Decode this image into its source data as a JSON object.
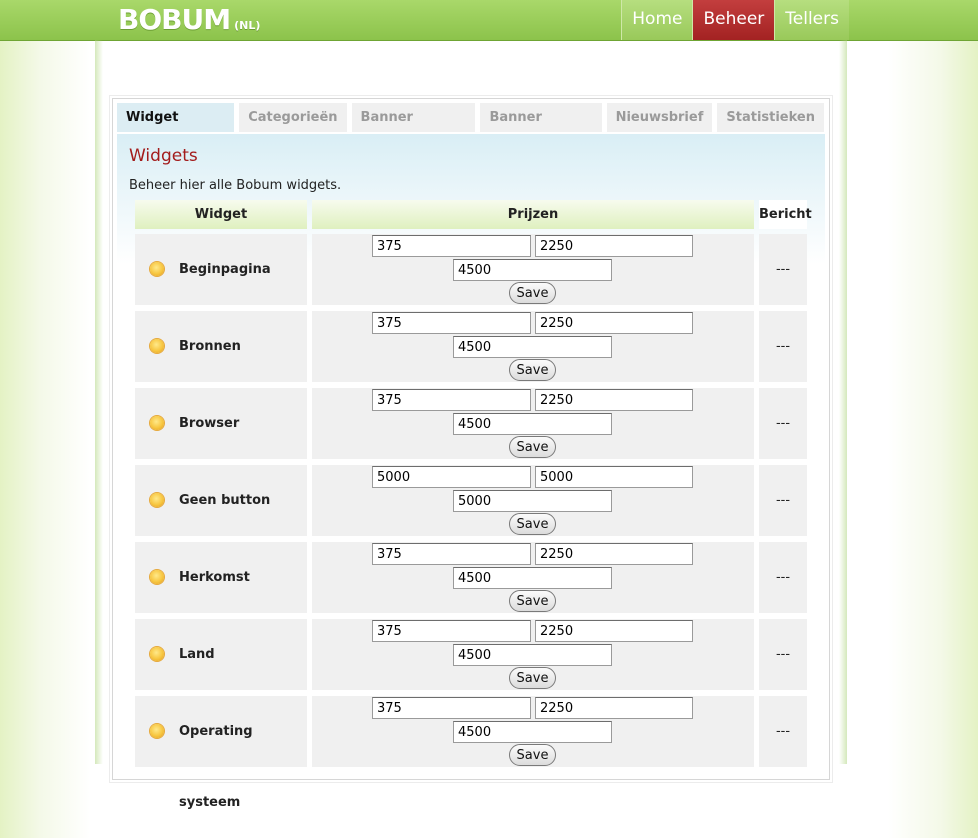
{
  "header": {
    "logo": "BOBUM",
    "logo_suffix": "(NL)",
    "nav": [
      "Home",
      "Beheer",
      "Tellers"
    ]
  },
  "tabs": [
    "Widget beheer",
    "Categorieën",
    "Banner beelden",
    "Banner teksten",
    "Nieuwsbrief",
    "Statistieken"
  ],
  "page": {
    "title": "Widgets",
    "intro": "Beheer hier alle Bobum widgets."
  },
  "table": {
    "headers": {
      "widget": "Widget",
      "prijzen": "Prijzen",
      "bericht": "Bericht"
    },
    "save_label": "Save",
    "rows": [
      {
        "name": "Beginpagina",
        "p1": "375",
        "p2": "2250",
        "p3": "4500",
        "bericht": "---"
      },
      {
        "name": "Bronnen",
        "p1": "375",
        "p2": "2250",
        "p3": "4500",
        "bericht": "---"
      },
      {
        "name": "Browser",
        "p1": "375",
        "p2": "2250",
        "p3": "4500",
        "bericht": "---"
      },
      {
        "name": "Geen button",
        "p1": "5000",
        "p2": "5000",
        "p3": "5000",
        "bericht": "---"
      },
      {
        "name": "Herkomst",
        "p1": "375",
        "p2": "2250",
        "p3": "4500",
        "bericht": "---"
      },
      {
        "name": "Land",
        "p1": "375",
        "p2": "2250",
        "p3": "4500",
        "bericht": "---"
      },
      {
        "name": "Operating systeem",
        "p1": "375",
        "p2": "2250",
        "p3": "4500",
        "bericht": "---"
      }
    ]
  },
  "colors": {
    "accent_green": "#8cc34b",
    "active_nav": "#a32222",
    "title_red": "#a31c1c"
  },
  "icons": {
    "widget_icon": "sun-icon"
  }
}
